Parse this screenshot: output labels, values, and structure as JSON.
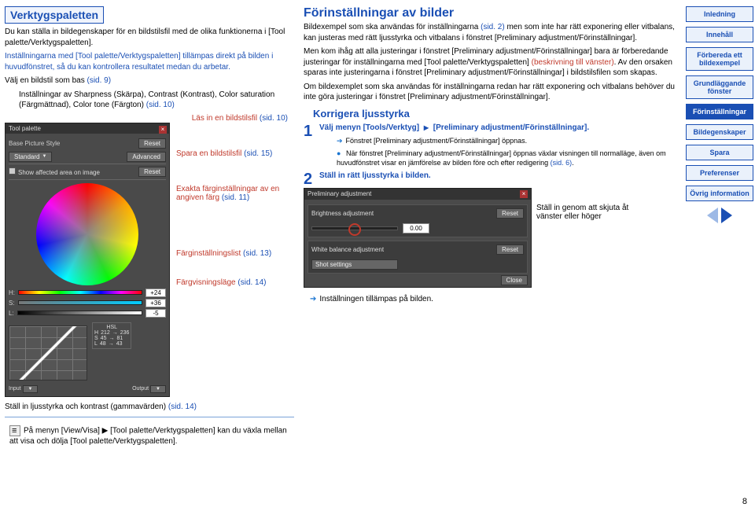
{
  "left": {
    "h_tool": "Verktygspaletten",
    "p_tool_1": "Du kan ställa in bildegenskaper för en bildstilsfil med de olika funktionerna i [Tool palette/Verktygspaletten].",
    "p_tool_2": "Inställningarna med [Tool palette/Verktygspaletten] tillämpas direkt på bilden i huvudfönstret, så du kan kontrollera resultatet medan du arbetar.",
    "bullet_base": "Välj en bildstil som bas",
    "bullet_base_ref": "(sid. 9)",
    "bullet_sharp": "Inställningar av Sharpness (Skärpa), Contrast (Kontrast), Color saturation (Färgmättnad), Color tone (Färgton)",
    "bullet_sharp_ref": "(sid. 10)",
    "label_read": "Läs in en bildstilsfil",
    "label_read_ref": "(sid. 10)",
    "label_save": "Spara en bildstilsfil",
    "label_save_ref": "(sid. 15)",
    "label_exact": "Exakta färginställningar av en angiven färg",
    "label_exact_ref": "(sid. 11)",
    "label_colorlist": "Färginställningslist",
    "label_colorlist_ref": "(sid. 13)",
    "label_colormode": "Färgvisningsläge",
    "label_colormode_ref": "(sid. 14)",
    "gamma_note": "Ställ in ljusstyrka och kontrast (gammavärden)",
    "gamma_ref": "(sid. 14)",
    "foot_note": "På menyn [View/Visa] ▶ [Tool palette/Verktygspaletten] kan du växla mellan att visa och dölja [Tool palette/Verktygspaletten].",
    "tp": {
      "title": "Tool palette",
      "base": "Base Picture Style",
      "standard": "Standard",
      "reset": "Reset",
      "advanced": "Advanced",
      "show_chk": "Show affected area on image",
      "h_lab": "H:",
      "h_val": "+24",
      "s_lab": "S:",
      "s_val": "+36",
      "l_lab": "L:",
      "l_val": "-5",
      "hsl_title": "HSL",
      "hsl_h": "H",
      "hsl_hv1": "212",
      "hsl_hv2": "236",
      "hsl_s": "S",
      "hsl_sv1": "45",
      "hsl_sv2": "81",
      "hsl_l": "L",
      "hsl_lv1": "48",
      "hsl_lv2": "43",
      "input": "Input",
      "output": "Output"
    }
  },
  "right": {
    "h_presets": "Förinställningar av bilder",
    "p_presets_1a": "Bildexempel som ska användas för inställningarna",
    "p_presets_1_ref": "(sid. 2)",
    "p_presets_1b": " men som inte har rätt exponering eller vitbalans, kan justeras med rätt ljusstyrka och vitbalans i fönstret [Preliminary adjustment/Förinställningar].",
    "p_presets_2a": "Men kom ihåg att alla justeringar i fönstret [Preliminary adjustment/Förinställningar] bara är förberedande justeringar för inställningarna med [Tool palette/Verktygspaletten] ",
    "p_presets_2_link": "(beskrivning till vänster)",
    "p_presets_2b": ". Av den orsaken sparas inte justeringarna i fönstret [Preliminary adjustment/Förinställningar] i bildstilsfilen som skapas.",
    "p_presets_3": "Om bildexemplet som ska användas för inställningarna redan har rätt exponering och vitbalans behöver du inte göra justeringar i fönstret [Preliminary adjustment/Förinställningar].",
    "h_correct": "Korrigera ljusstyrka",
    "step1_a": "Välj menyn [Tools/Verktyg]",
    "step1_b": "[Preliminary adjustment/Förinställningar].",
    "step1_sub1": "Fönstret [Preliminary adjustment/Förinställningar] öppnas.",
    "step1_sub2": "När fönstret [Preliminary adjustment/Förinställningar] öppnas växlar visningen till normalläge, även om huvudfönstret visar en jämförelse av bilden före och efter redigering",
    "step1_sub2_ref": "(sid. 6)",
    "step2": "Ställ in rätt ljusstyrka i bilden.",
    "pa": {
      "title": "Preliminary adjustment",
      "brightness_lbl": "Brightness adjustment",
      "reset": "Reset",
      "bright_val": "0.00",
      "wb_lbl": "White balance adjustment",
      "shot": "Shot settings",
      "close": "Close"
    },
    "drag_note": "Ställ in genom att skjuta åt vänster eller höger",
    "applied": "Inställningen tillämpas på bilden."
  },
  "nav": {
    "items": [
      "Inledning",
      "Innehåll",
      "Förbereda ett bildexempel",
      "Grundläggande fönster",
      "Förinställningar",
      "Bildegenskaper",
      "Spara",
      "Preferenser",
      "Övrig information"
    ]
  },
  "page_num": "8"
}
